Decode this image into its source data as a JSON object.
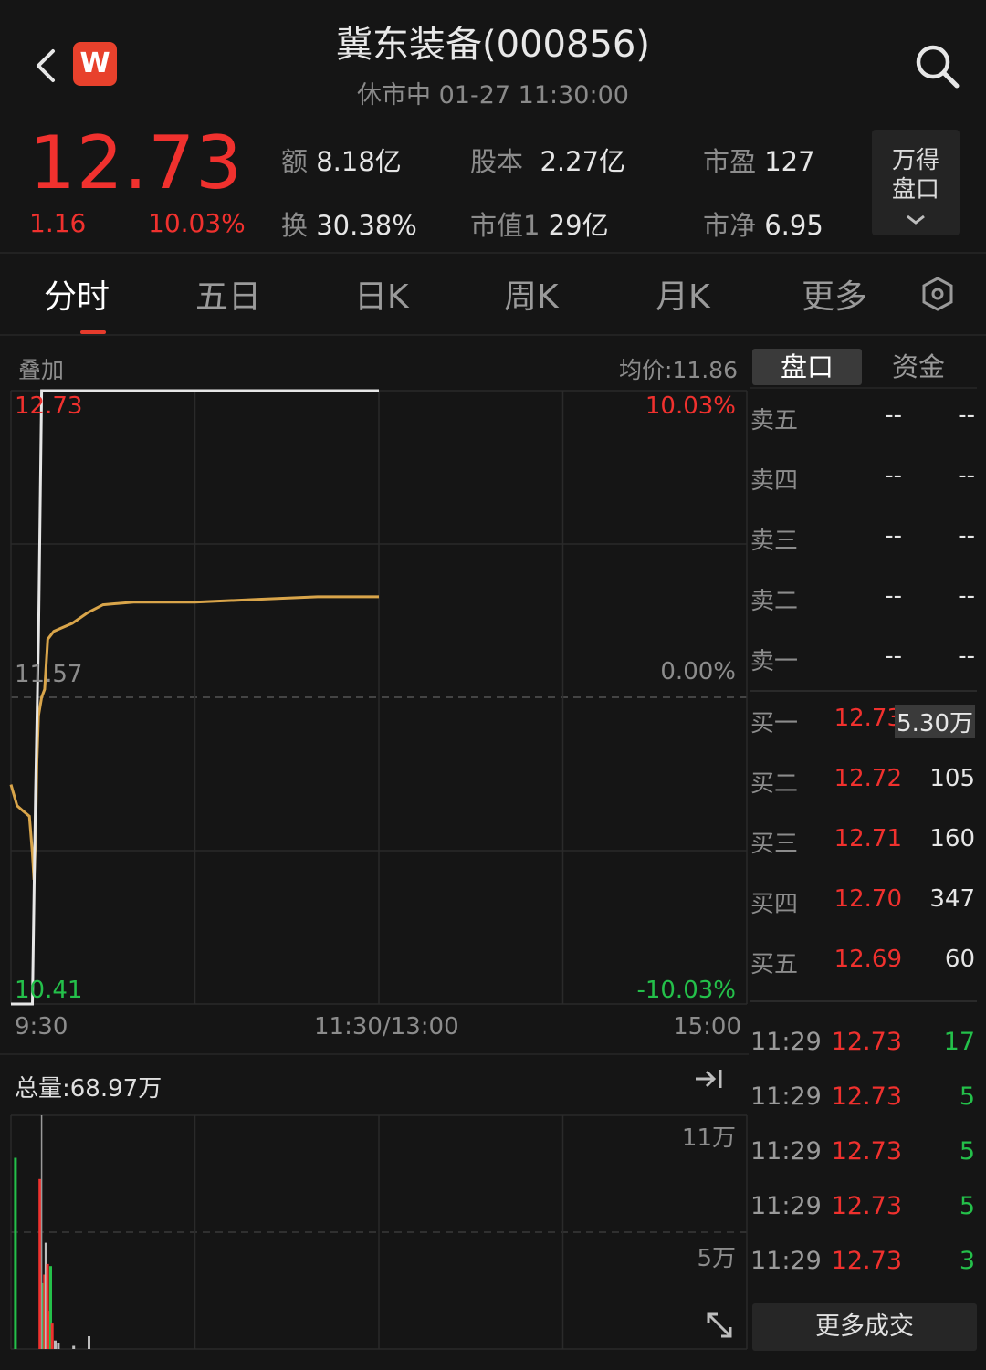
{
  "header": {
    "title": "冀东装备(000856)",
    "status": "休市中  01-27 11:30:00",
    "logo_letter": "W"
  },
  "quote": {
    "price": "12.73",
    "change": "1.16",
    "change_pct": "10.03%",
    "stats": [
      {
        "label": "额",
        "value": "8.18亿"
      },
      {
        "label": "股本",
        "value": "2.27亿"
      },
      {
        "label": "市盈",
        "value": "127"
      },
      {
        "label": "换",
        "value": "30.38%"
      },
      {
        "label": "市值1",
        "value": "29亿"
      },
      {
        "label": "市净",
        "value": "6.95"
      }
    ],
    "wande_btn_line1": "万得",
    "wande_btn_line2": "盘口"
  },
  "tabs": [
    "分时",
    "五日",
    "日K",
    "周K",
    "月K",
    "更多"
  ],
  "active_tab": "分时",
  "chart": {
    "overlay_label": "叠加",
    "avg_label": "均价:11.86",
    "price_high": "12.73",
    "price_mid": "11.57",
    "price_low": "10.41",
    "pct_high": "10.03%",
    "pct_mid": "0.00%",
    "pct_low": "-10.03%",
    "time_start": "9:30",
    "time_mid": "11:30/13:00",
    "time_end": "15:00",
    "total_volume": "总量:68.97万",
    "vol_max_label": "11万",
    "vol_mid_label": "5万",
    "colors": {
      "price_line": "#e6e6e6",
      "avg_line": "#d9a54a",
      "up": "#f0312e",
      "down": "#24c04a"
    }
  },
  "chart_data": {
    "type": "line",
    "title": "",
    "xlabel": "",
    "ylabel": "",
    "ylim": [
      10.41,
      12.73
    ],
    "x_range_minutes": [
      0,
      240
    ],
    "series": [
      {
        "key": "price",
        "x": [
          0,
          1,
          2,
          3,
          4,
          5,
          6,
          7,
          8,
          9,
          10,
          12,
          20,
          30,
          60,
          120
        ],
        "values": [
          10.41,
          10.41,
          10.41,
          10.41,
          10.41,
          10.41,
          10.41,
          10.41,
          11.2,
          11.8,
          12.73,
          12.73,
          12.73,
          12.73,
          12.73,
          12.73
        ]
      },
      {
        "key": "avg",
        "x": [
          0,
          2,
          4,
          6,
          7,
          7.5,
          8,
          8.5,
          9,
          10,
          11,
          12,
          14,
          20,
          25,
          30,
          40,
          60,
          80,
          100,
          120
        ],
        "values": [
          11.24,
          11.16,
          11.14,
          11.12,
          10.98,
          10.88,
          11.03,
          11.33,
          11.5,
          11.57,
          11.6,
          11.79,
          11.82,
          11.85,
          11.89,
          11.92,
          11.93,
          11.93,
          11.94,
          11.95,
          11.95
        ]
      }
    ],
    "volume_x": [
      1,
      9,
      10,
      10.5,
      11,
      11.5,
      12,
      12.5,
      13,
      14,
      15,
      20,
      25
    ],
    "volume_values": [
      90000,
      80000,
      31000,
      35000,
      50000,
      40000,
      18000,
      39000,
      12000,
      4000,
      3000,
      1500,
      6000
    ],
    "volume_colors": [
      "green",
      "red",
      "green",
      "red",
      "white",
      "red",
      "red",
      "green",
      "red",
      "white",
      "white",
      "white",
      "white"
    ],
    "volume_ylim": [
      0,
      110000
    ]
  },
  "orderbook": {
    "tabs": [
      "盘口",
      "资金"
    ],
    "asks": [
      {
        "level": "卖五",
        "price": "--",
        "volume": "--"
      },
      {
        "level": "卖四",
        "price": "--",
        "volume": "--"
      },
      {
        "level": "卖三",
        "price": "--",
        "volume": "--"
      },
      {
        "level": "卖二",
        "price": "--",
        "volume": "--"
      },
      {
        "level": "卖一",
        "price": "--",
        "volume": "--"
      }
    ],
    "bids": [
      {
        "level": "买一",
        "price": "12.73",
        "volume": "5.30万"
      },
      {
        "level": "买二",
        "price": "12.72",
        "volume": "105"
      },
      {
        "level": "买三",
        "price": "12.71",
        "volume": "160"
      },
      {
        "level": "买四",
        "price": "12.70",
        "volume": "347"
      },
      {
        "level": "买五",
        "price": "12.69",
        "volume": "60"
      }
    ]
  },
  "trades": [
    {
      "time": "11:29",
      "price": "12.73",
      "volume": "17"
    },
    {
      "time": "11:29",
      "price": "12.73",
      "volume": "5"
    },
    {
      "time": "11:29",
      "price": "12.73",
      "volume": "5"
    },
    {
      "time": "11:29",
      "price": "12.73",
      "volume": "5"
    },
    {
      "time": "11:29",
      "price": "12.73",
      "volume": "3"
    }
  ],
  "more_trades_label": "更多成交"
}
